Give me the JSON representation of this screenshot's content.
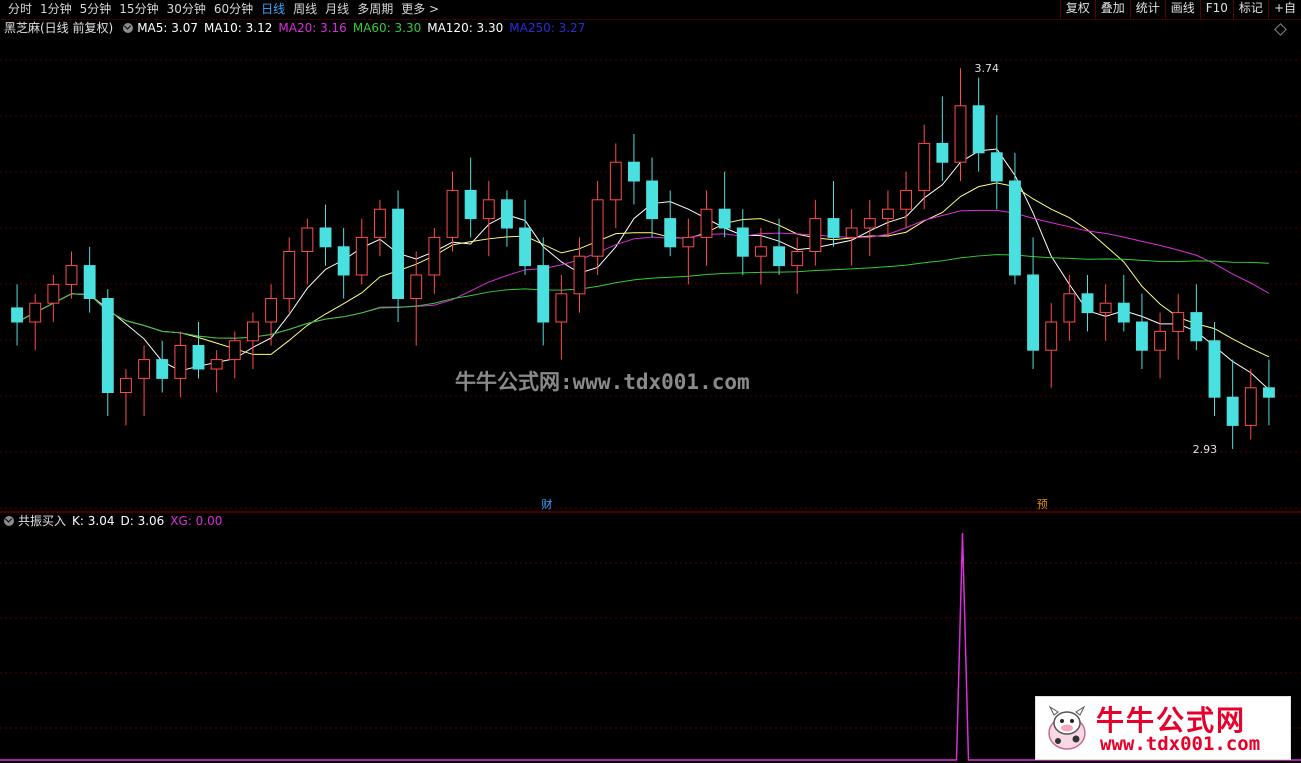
{
  "toolbar": {
    "tabs": [
      "分时",
      "1分钟",
      "5分钟",
      "15分钟",
      "30分钟",
      "60分钟",
      "日线",
      "周线",
      "月线",
      "多周期",
      "更多 >"
    ],
    "active_tab": 6,
    "tools": [
      "复权",
      "叠加",
      "统计",
      "画线",
      "F10",
      "标记",
      "+自"
    ]
  },
  "main_panel": {
    "title": "黑芝麻(日线 前复权)",
    "indicators": [
      {
        "label": "MA5: 3.07",
        "color": "#ffffff"
      },
      {
        "label": "MA10: 3.12",
        "color": "#ffffff"
      },
      {
        "label": "MA20: 3.16",
        "color": "#d92ed9"
      },
      {
        "label": "MA60: 3.30",
        "color": "#33cc33"
      },
      {
        "label": "MA120: 3.30",
        "color": "#ffffff"
      },
      {
        "label": "MA250: 3.27",
        "color": "#2a2ad9"
      }
    ],
    "high_label": "3.74",
    "low_label": "2.93",
    "markers": [
      {
        "text": "财",
        "color": "#3aa6ff"
      },
      {
        "text": "预",
        "color": "#e08a00"
      }
    ]
  },
  "sub_panel": {
    "title": "共振买入",
    "indicators": [
      {
        "label": "K: 3.04",
        "color": "#ffffff"
      },
      {
        "label": "D: 3.06",
        "color": "#ffffff"
      },
      {
        "label": "XG: 0.00",
        "color": "#d92ed9"
      }
    ]
  },
  "watermark": {
    "text": "牛牛公式网:www.tdx001.com"
  },
  "logo": {
    "title": "牛牛公式网",
    "url": "www.tdx001.com"
  },
  "colors": {
    "up": "#ff4a4a",
    "down": "#4ae0e0",
    "ma5": "#ffffff",
    "ma10": "#ffff80",
    "ma20": "#d92ed9",
    "ma60": "#33cc33",
    "ma120": "#ffffff",
    "ma250": "#2a2ad9",
    "grid": "#5a0000"
  },
  "chart_data": {
    "type": "candlestick",
    "title": "黑芝麻(日线 前复权)",
    "ylim": [
      2.8,
      3.8
    ],
    "series": [
      {
        "name": "K线",
        "values": [
          [
            3.23,
            3.28,
            3.15,
            3.2
          ],
          [
            3.2,
            3.26,
            3.14,
            3.24
          ],
          [
            3.24,
            3.3,
            3.2,
            3.28
          ],
          [
            3.28,
            3.35,
            3.25,
            3.32
          ],
          [
            3.32,
            3.36,
            3.22,
            3.25
          ],
          [
            3.25,
            3.27,
            3.0,
            3.05
          ],
          [
            3.05,
            3.1,
            2.98,
            3.08
          ],
          [
            3.08,
            3.15,
            3.0,
            3.12
          ],
          [
            3.12,
            3.16,
            3.05,
            3.08
          ],
          [
            3.08,
            3.18,
            3.04,
            3.15
          ],
          [
            3.15,
            3.2,
            3.08,
            3.1
          ],
          [
            3.1,
            3.14,
            3.05,
            3.12
          ],
          [
            3.12,
            3.18,
            3.08,
            3.16
          ],
          [
            3.16,
            3.22,
            3.1,
            3.2
          ],
          [
            3.2,
            3.28,
            3.15,
            3.25
          ],
          [
            3.25,
            3.38,
            3.22,
            3.35
          ],
          [
            3.35,
            3.42,
            3.28,
            3.4
          ],
          [
            3.4,
            3.45,
            3.32,
            3.36
          ],
          [
            3.36,
            3.4,
            3.25,
            3.3
          ],
          [
            3.3,
            3.42,
            3.28,
            3.38
          ],
          [
            3.38,
            3.46,
            3.34,
            3.44
          ],
          [
            3.44,
            3.48,
            3.2,
            3.25
          ],
          [
            3.25,
            3.35,
            3.15,
            3.3
          ],
          [
            3.3,
            3.4,
            3.26,
            3.38
          ],
          [
            3.38,
            3.52,
            3.35,
            3.48
          ],
          [
            3.48,
            3.55,
            3.38,
            3.42
          ],
          [
            3.42,
            3.5,
            3.34,
            3.46
          ],
          [
            3.46,
            3.48,
            3.36,
            3.4
          ],
          [
            3.4,
            3.46,
            3.3,
            3.32
          ],
          [
            3.32,
            3.38,
            3.15,
            3.2
          ],
          [
            3.2,
            3.3,
            3.12,
            3.26
          ],
          [
            3.26,
            3.38,
            3.22,
            3.34
          ],
          [
            3.34,
            3.5,
            3.3,
            3.46
          ],
          [
            3.46,
            3.58,
            3.4,
            3.54
          ],
          [
            3.54,
            3.6,
            3.45,
            3.5
          ],
          [
            3.5,
            3.55,
            3.38,
            3.42
          ],
          [
            3.42,
            3.48,
            3.34,
            3.36
          ],
          [
            3.36,
            3.42,
            3.28,
            3.38
          ],
          [
            3.38,
            3.48,
            3.32,
            3.44
          ],
          [
            3.44,
            3.52,
            3.38,
            3.4
          ],
          [
            3.4,
            3.44,
            3.3,
            3.34
          ],
          [
            3.34,
            3.4,
            3.28,
            3.36
          ],
          [
            3.36,
            3.42,
            3.3,
            3.32
          ],
          [
            3.32,
            3.38,
            3.26,
            3.35
          ],
          [
            3.35,
            3.46,
            3.32,
            3.42
          ],
          [
            3.42,
            3.5,
            3.36,
            3.38
          ],
          [
            3.38,
            3.44,
            3.32,
            3.4
          ],
          [
            3.4,
            3.46,
            3.34,
            3.42
          ],
          [
            3.42,
            3.48,
            3.38,
            3.44
          ],
          [
            3.44,
            3.52,
            3.4,
            3.48
          ],
          [
            3.48,
            3.62,
            3.44,
            3.58
          ],
          [
            3.58,
            3.68,
            3.5,
            3.54
          ],
          [
            3.54,
            3.74,
            3.5,
            3.66
          ],
          [
            3.66,
            3.72,
            3.52,
            3.56
          ],
          [
            3.56,
            3.64,
            3.44,
            3.5
          ],
          [
            3.5,
            3.56,
            3.28,
            3.3
          ],
          [
            3.3,
            3.38,
            3.1,
            3.14
          ],
          [
            3.14,
            3.24,
            3.06,
            3.2
          ],
          [
            3.2,
            3.3,
            3.16,
            3.26
          ],
          [
            3.26,
            3.3,
            3.18,
            3.22
          ],
          [
            3.22,
            3.28,
            3.16,
            3.24
          ],
          [
            3.24,
            3.3,
            3.18,
            3.2
          ],
          [
            3.2,
            3.26,
            3.1,
            3.14
          ],
          [
            3.14,
            3.22,
            3.08,
            3.18
          ],
          [
            3.18,
            3.26,
            3.12,
            3.22
          ],
          [
            3.22,
            3.28,
            3.14,
            3.16
          ],
          [
            3.16,
            3.2,
            3.0,
            3.04
          ],
          [
            3.04,
            3.12,
            2.93,
            2.98
          ],
          [
            2.98,
            3.1,
            2.95,
            3.06
          ],
          [
            3.06,
            3.12,
            2.98,
            3.04
          ]
        ]
      }
    ]
  }
}
